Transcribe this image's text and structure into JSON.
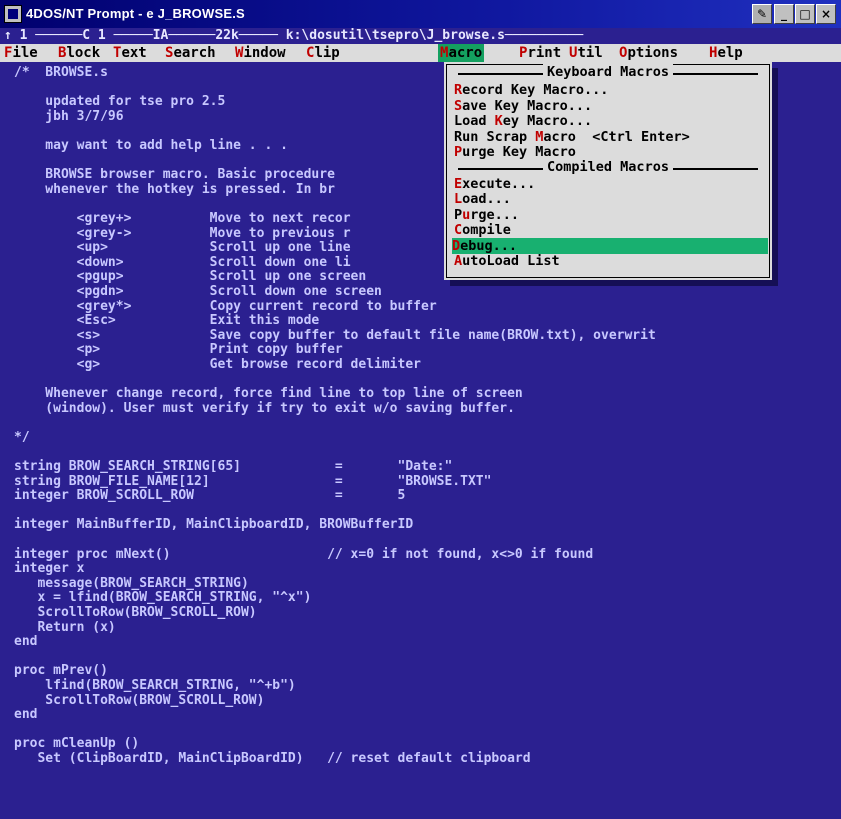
{
  "window": {
    "title": "4DOS/NT Prompt - e J_BROWSE.S",
    "controls": {
      "tools": "✎",
      "minimize": "_",
      "maximize": "□",
      "close": "×"
    }
  },
  "status_line": "↑ 1 ──────C 1 ─────IA──────22k───── k:\\dosutil\\tsepro\\J_browse.s──────────",
  "menubar": [
    {
      "pre": "",
      "hk": "F",
      "rest": "ile",
      "active": false
    },
    {
      "pre": "",
      "hk": "B",
      "rest": "lock",
      "active": false
    },
    {
      "pre": "",
      "hk": "T",
      "rest": "ext",
      "active": false
    },
    {
      "pre": "",
      "hk": "S",
      "rest": "earch",
      "active": false
    },
    {
      "pre": "",
      "hk": "W",
      "rest": "indow",
      "active": false
    },
    {
      "pre": "",
      "hk": "C",
      "rest": "lip",
      "active": false
    },
    {
      "pre": "",
      "hk": "M",
      "rest": "acro",
      "active": true
    },
    {
      "pre": "",
      "hk": "P",
      "rest": "rint",
      "active": false
    },
    {
      "pre": "",
      "hk": "U",
      "rest": "til",
      "active": false
    },
    {
      "pre": "",
      "hk": "O",
      "rest": "ptions",
      "active": false
    },
    {
      "pre": "",
      "hk": "H",
      "rest": "elp",
      "active": false
    }
  ],
  "macro_menu": {
    "header_keyboard": "Keyboard Macros",
    "header_compiled": "Compiled Macros",
    "keyboard_items": [
      {
        "pre": "",
        "hk": "R",
        "rest": "ecord Key Macro..."
      },
      {
        "pre": "",
        "hk": "S",
        "rest": "ave Key Macro..."
      },
      {
        "pre": "Load ",
        "hk": "K",
        "rest": "ey Macro..."
      },
      {
        "pre": "Run Scrap ",
        "hk": "M",
        "rest": "acro  <Ctrl Enter>"
      },
      {
        "pre": "",
        "hk": "P",
        "rest": "urge Key Macro"
      }
    ],
    "compiled_items": [
      {
        "pre": "",
        "hk": "E",
        "rest": "xecute...",
        "selected": false
      },
      {
        "pre": "",
        "hk": "L",
        "rest": "oad...",
        "selected": false
      },
      {
        "pre": "P",
        "hk": "u",
        "rest": "rge...",
        "selected": false
      },
      {
        "pre": "",
        "hk": "C",
        "rest": "ompile",
        "selected": false
      },
      {
        "pre": "",
        "hk": "D",
        "rest": "ebug...",
        "selected": true
      },
      {
        "pre": "",
        "hk": "A",
        "rest": "utoLoad List",
        "selected": false
      }
    ]
  },
  "code_lines": [
    "/*  BROWSE.s",
    "",
    "    updated for tse pro 2.5",
    "    jbh 3/7/96",
    "",
    "    may want to add help line . . .",
    "",
    "    BROWSE browser macro. Basic procedure",
    "    whenever the hotkey is pressed. In br",
    "",
    "        <grey+>          Move to next recor",
    "        <grey->          Move to previous r",
    "        <up>             Scroll up one line",
    "        <down>           Scroll down one li",
    "        <pgup>           Scroll up one screen",
    "        <pgdn>           Scroll down one screen",
    "        <grey*>          Copy current record to buffer",
    "        <Esc>            Exit this mode",
    "        <s>              Save copy buffer to default file name(BROW.txt), overwrit",
    "        <p>              Print copy buffer",
    "        <g>              Get browse record delimiter",
    "",
    "    Whenever change record, force find line to top line of screen",
    "    (window). User must verify if try to exit w/o saving buffer.",
    "",
    "*/",
    "",
    "string BROW_SEARCH_STRING[65]            =       \"Date:\"",
    "string BROW_FILE_NAME[12]                =       \"BROWSE.TXT\"",
    "integer BROW_SCROLL_ROW                  =       5",
    "",
    "integer MainBufferID, MainClipboardID, BROWBufferID",
    "",
    "integer proc mNext()                    // x=0 if not found, x<>0 if found",
    "integer x",
    "   message(BROW_SEARCH_STRING)",
    "   x = lfind(BROW_SEARCH_STRING, \"^x\")",
    "   ScrollToRow(BROW_SCROLL_ROW)",
    "   Return (x)",
    "end",
    "",
    "proc mPrev()",
    "    lfind(BROW_SEARCH_STRING, \"^+b\")",
    "    ScrollToRow(BROW_SCROLL_ROW)",
    "end",
    "",
    "proc mCleanUp ()",
    "   Set (ClipBoardID, MainClipBoardID)   // reset default clipboard"
  ]
}
